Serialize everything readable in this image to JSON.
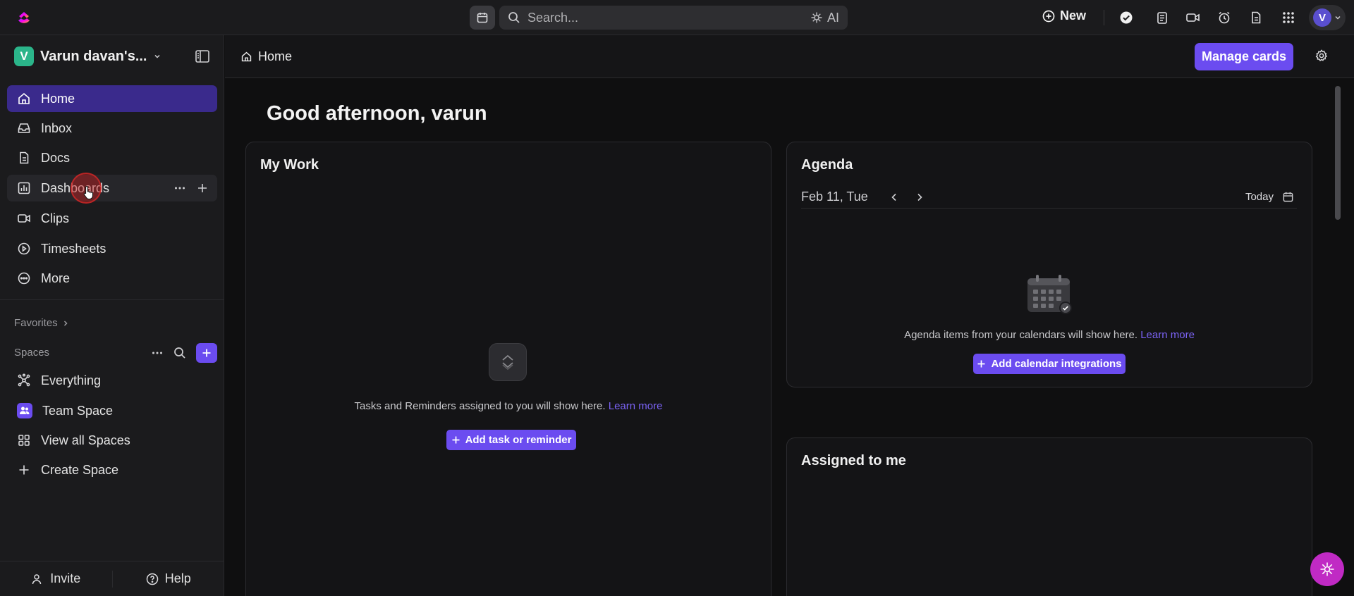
{
  "topbar": {
    "search_placeholder": "Search...",
    "ai_label": "AI",
    "new_label": "New",
    "avatar_initial": "V"
  },
  "sidebar": {
    "workspace_initial": "V",
    "workspace_name": "Varun davan's...",
    "nav": [
      {
        "label": "Home",
        "icon": "home-icon"
      },
      {
        "label": "Inbox",
        "icon": "inbox-icon"
      },
      {
        "label": "Docs",
        "icon": "doc-icon"
      },
      {
        "label": "Dashboards",
        "icon": "dashboard-icon"
      },
      {
        "label": "Clips",
        "icon": "clip-icon"
      },
      {
        "label": "Timesheets",
        "icon": "timesheet-icon"
      },
      {
        "label": "More",
        "icon": "more-icon"
      }
    ],
    "favorites_label": "Favorites",
    "spaces_label": "Spaces",
    "spaces": [
      {
        "label": "Everything",
        "icon": "everything-icon"
      },
      {
        "label": "Team Space",
        "icon": "team-icon"
      },
      {
        "label": "View all Spaces",
        "icon": "grid-icon"
      },
      {
        "label": "Create Space",
        "icon": "plus-icon"
      }
    ],
    "invite_label": "Invite",
    "help_label": "Help"
  },
  "main": {
    "breadcrumb": "Home",
    "manage_cards": "Manage cards",
    "greeting": "Good afternoon, varun",
    "my_work": {
      "title": "My Work",
      "empty_text": "Tasks and Reminders assigned to you will show here.",
      "learn_more": "Learn more",
      "button": "Add task or reminder"
    },
    "agenda": {
      "title": "Agenda",
      "date": "Feb 11, Tue",
      "today": "Today",
      "empty_text": "Agenda items from your calendars will show here.",
      "learn_more": "Learn more",
      "button": "Add calendar integrations"
    },
    "assigned": {
      "title": "Assigned to me"
    }
  },
  "colors": {
    "accent": "#6b4cf0",
    "active_nav": "#3a2a8c",
    "workspace_badge": "#2bb58a",
    "fab": "#c02ac4"
  }
}
